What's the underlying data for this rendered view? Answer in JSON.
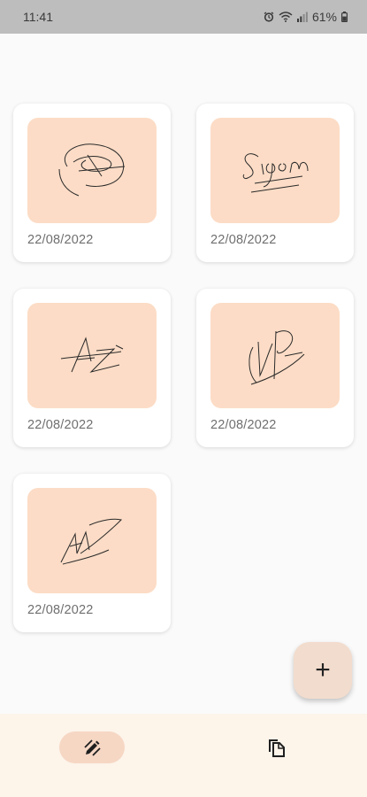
{
  "status_bar": {
    "time": "11:41",
    "battery": "61%",
    "icons": [
      "alarm-icon",
      "wifi-icon",
      "signal-icon",
      "battery-icon"
    ]
  },
  "signatures": [
    {
      "date": "22/08/2022",
      "icon": "signature-drawing"
    },
    {
      "date": "22/08/2022",
      "icon": "signature-drawing"
    },
    {
      "date": "22/08/2022",
      "icon": "signature-drawing"
    },
    {
      "date": "22/08/2022",
      "icon": "signature-drawing"
    },
    {
      "date": "22/08/2022",
      "icon": "signature-drawing"
    }
  ],
  "fab": {
    "label": "+",
    "icon": "plus-icon"
  },
  "bottom_nav": {
    "items": [
      {
        "icon": "draw-pen-icon",
        "active": true
      },
      {
        "icon": "copy-documents-icon",
        "active": false
      }
    ]
  },
  "colors": {
    "thumb_bg": "#fcdcc6",
    "fab_bg": "#f2dccd",
    "nav_bg": "#fdf4ea",
    "nav_active": "#f6d7c4"
  }
}
